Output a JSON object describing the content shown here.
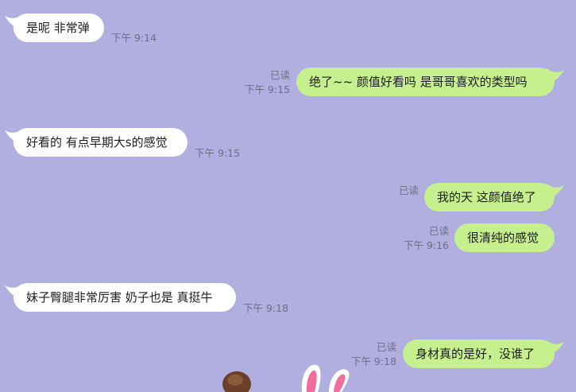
{
  "colors": {
    "background": "#b1aee0",
    "incoming_bubble": "#ffffff",
    "outgoing_bubble": "#c6f08e",
    "meta_text": "#6f6d86"
  },
  "messages": [
    {
      "direction": "incoming",
      "text": "是呢 非常弹",
      "time": "下午 9:14"
    },
    {
      "direction": "outgoing",
      "text": "绝了~~  颜值好看吗 是哥哥喜欢的类型吗",
      "read": "已读",
      "time": "下午 9:15"
    },
    {
      "direction": "incoming",
      "text": "好看的 有点早期大s的感觉",
      "time": "下午 9:15"
    },
    {
      "direction": "outgoing",
      "text": "我的天 这颜值绝了",
      "read": "已读"
    },
    {
      "direction": "outgoing",
      "text": "很清纯的感觉",
      "read": "已读",
      "time": "下午 9:16"
    },
    {
      "direction": "incoming",
      "text": "妹子臀腿非常厉害 奶子也是 真挺牛",
      "time": "下午 9:18"
    },
    {
      "direction": "outgoing",
      "text": "身材真的是好，没谁了",
      "read": "已读",
      "time": "下午 9:18"
    }
  ],
  "sticker": {
    "icon": "bunny-ears-sticker"
  }
}
